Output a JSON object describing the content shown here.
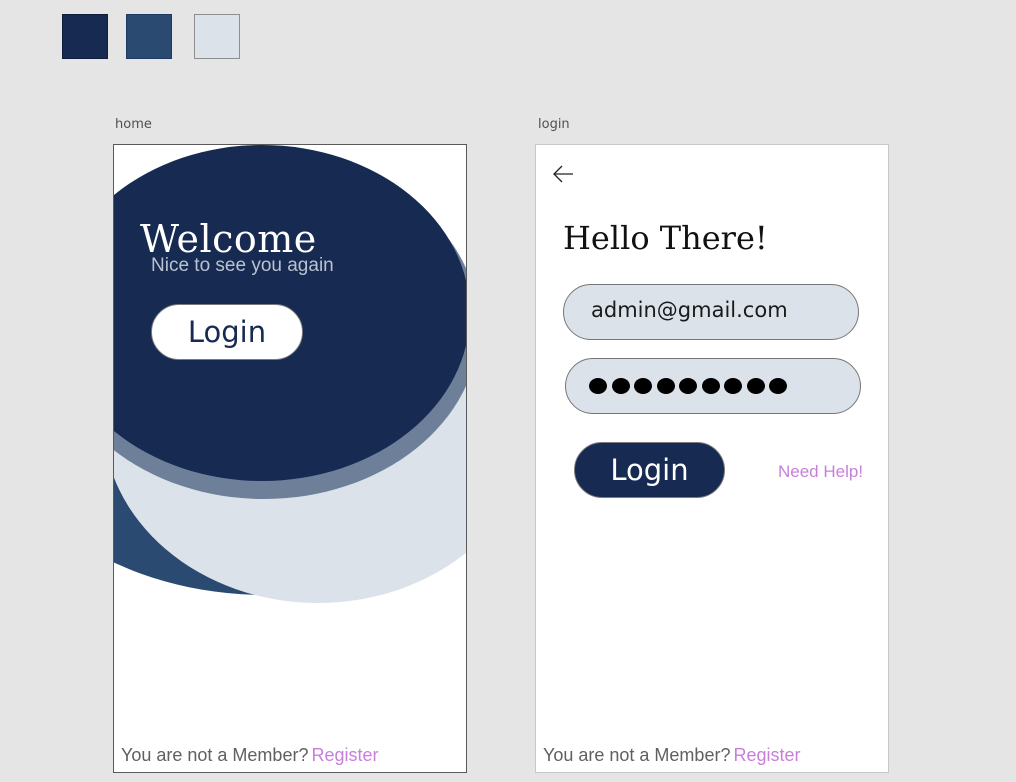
{
  "palette": {
    "colors": [
      "#172a52",
      "#2a4a72",
      "#dce2e9"
    ]
  },
  "home": {
    "artboard_label": "home",
    "title": "Welcome",
    "subtitle": "Nice to see you again",
    "login_button": "Login",
    "footer_text": "You are not a Member?",
    "register_link": "Register"
  },
  "login": {
    "artboard_label": "login",
    "back_icon": "arrow-left-icon",
    "title": "Hello There!",
    "email_value": "admin@gmail.com",
    "password_value": "●●●●●●●●●",
    "login_button": "Login",
    "need_help_link": "Need Help!",
    "footer_text": "You are not a Member?",
    "register_link": "Register"
  }
}
